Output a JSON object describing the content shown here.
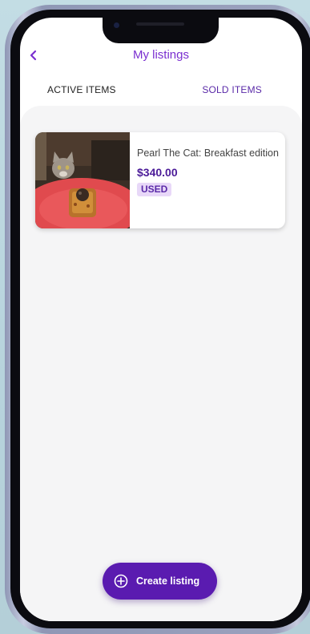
{
  "header": {
    "back_icon": "chevron-left-icon",
    "title": "My listings"
  },
  "tabs": [
    {
      "label": "ACTIVE ITEMS"
    },
    {
      "label": "SOLD ITEMS"
    }
  ],
  "listings": [
    {
      "title": "Pearl The Cat: Breakfast edition",
      "price": "$340.00",
      "condition": "USED",
      "image": "cat-and-waffle-photo"
    }
  ],
  "actions": {
    "create_icon": "plus-circle-icon",
    "create_label": "Create listing"
  },
  "colors": {
    "accent": "#7a2fd0",
    "button": "#5a1bb0",
    "price": "#4b1b98",
    "badge_bg": "#e8d8f8"
  }
}
